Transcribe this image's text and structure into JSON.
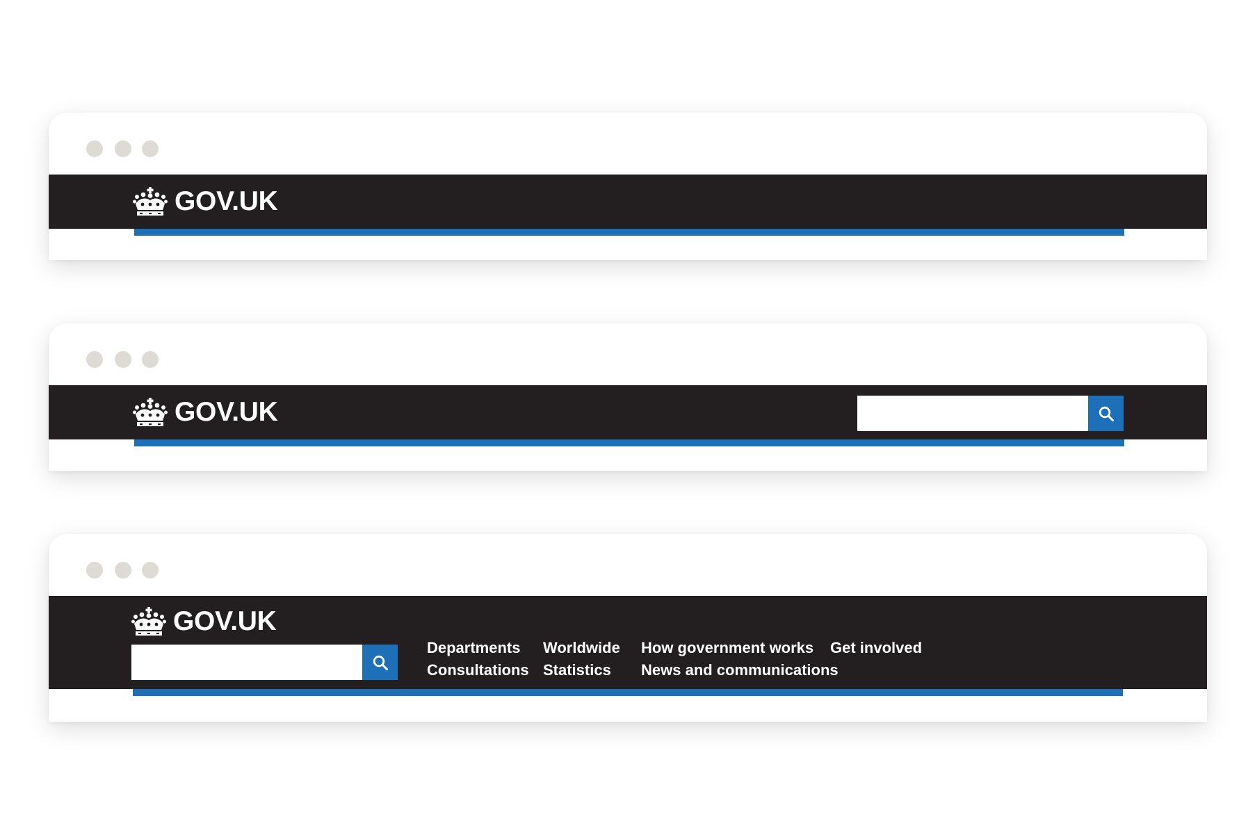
{
  "colors": {
    "header_background": "#231f20",
    "brand_blue": "#1d70b8",
    "window_dot": "#dedbd5",
    "text_on_dark": "#ffffff",
    "search_field": "#ffffff"
  },
  "brand": {
    "logo_text": "GOV.UK",
    "logo_icon": "crown-icon"
  },
  "search": {
    "value": "",
    "placeholder": "",
    "button_icon": "search-icon"
  },
  "window_controls": {
    "dot_count": 3
  },
  "frames": [
    {
      "id": "logo-only",
      "has_search": false,
      "has_navigation": false
    },
    {
      "id": "logo-and-search",
      "has_search": true,
      "has_navigation": false
    },
    {
      "id": "logo-search-and-navigation",
      "has_search": true,
      "has_navigation": true
    }
  ],
  "navigation": {
    "items": [
      {
        "label": "Departments"
      },
      {
        "label": "Worldwide"
      },
      {
        "label": "How government works"
      },
      {
        "label": "Get involved"
      },
      {
        "label": "Consultations"
      },
      {
        "label": "Statistics"
      },
      {
        "label": "News and communications"
      }
    ]
  }
}
